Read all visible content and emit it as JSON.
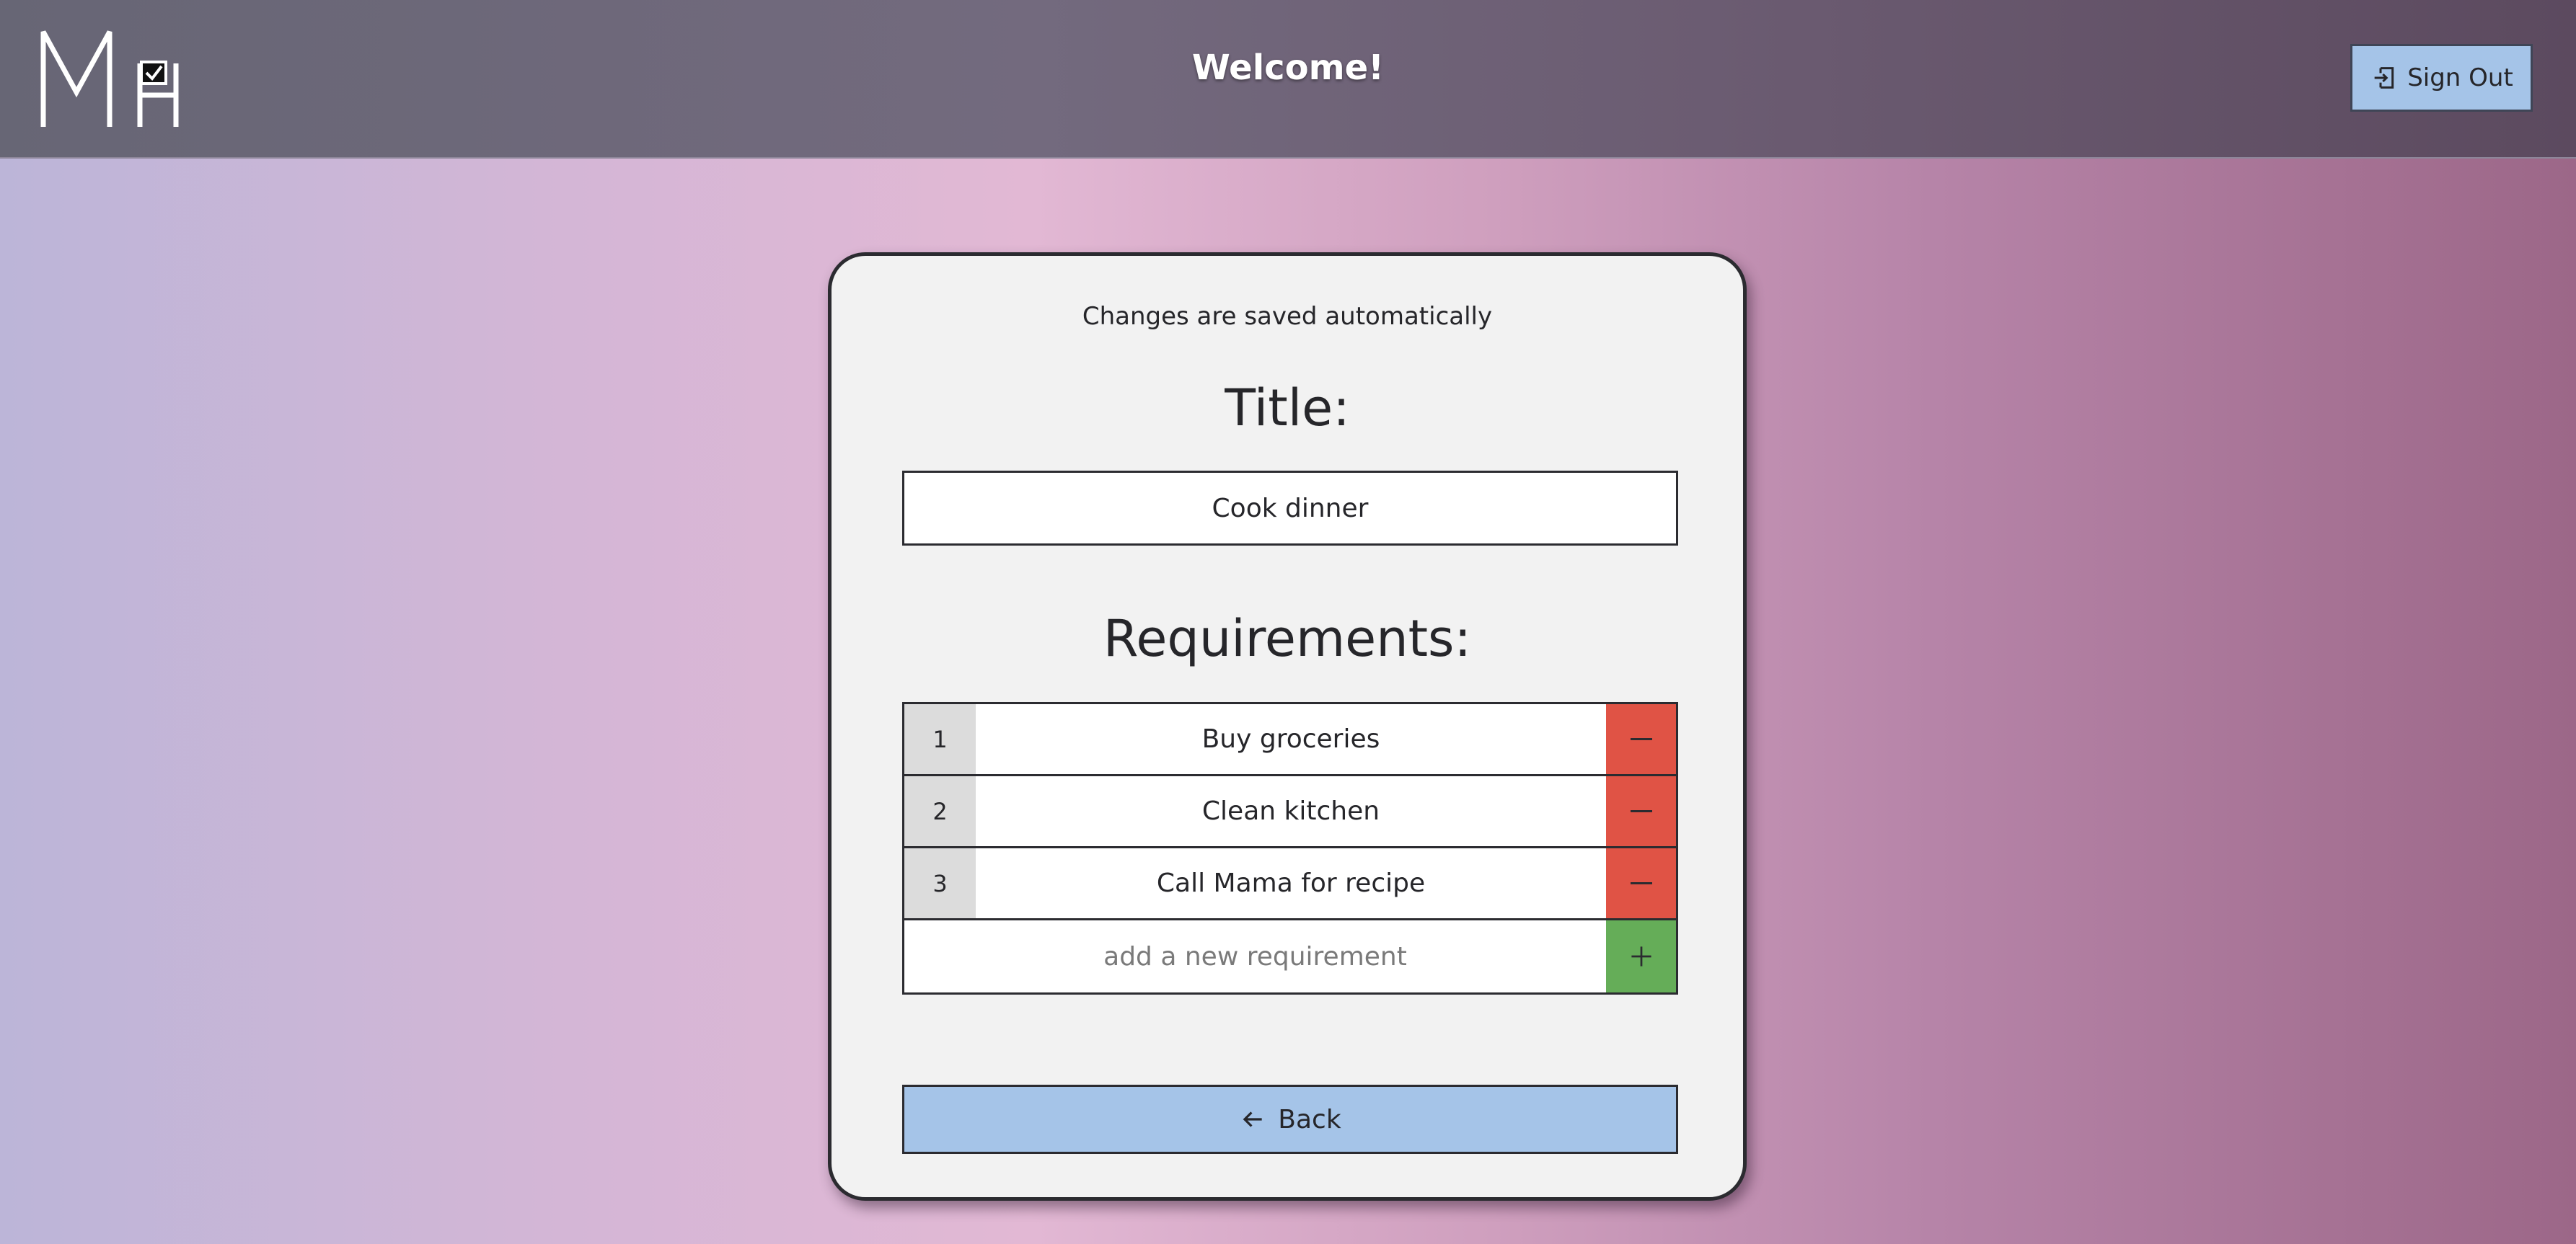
{
  "header": {
    "title": "Welcome!",
    "signout_label": "Sign Out",
    "logo_icon": "mh-checkbox-logo"
  },
  "card": {
    "autosave_note": "Changes are saved automatically",
    "title_label": "Title:",
    "title_value": "Cook dinner",
    "requirements_label": "Requirements:",
    "requirements": [
      {
        "number": "1",
        "text": "Buy groceries"
      },
      {
        "number": "2",
        "text": "Clean kitchen"
      },
      {
        "number": "3",
        "text": "Call Mama for recipe"
      }
    ],
    "new_requirement_placeholder": "add a new requirement",
    "back_label": "Back"
  },
  "colors": {
    "remove": "#e05345",
    "add": "#65ad58",
    "button": "#a5c4e8"
  }
}
